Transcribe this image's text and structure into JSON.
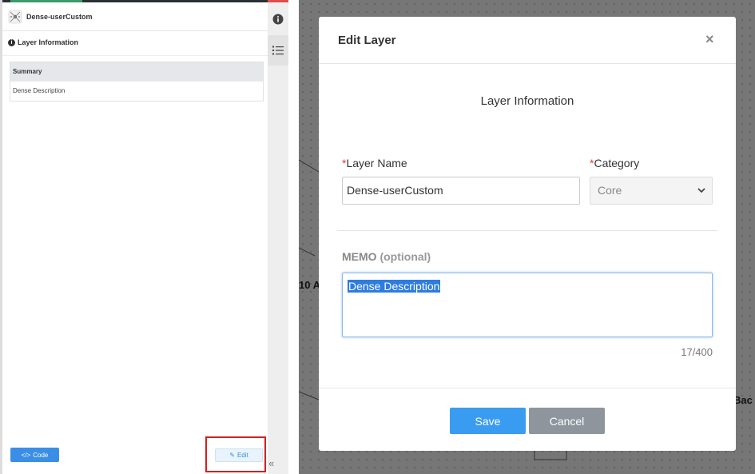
{
  "left_panel": {
    "header_title": "Dense-userCustom",
    "section_title": "Layer Information",
    "summary_header": "Summary",
    "summary_value": "Dense Description",
    "code_button": "Code",
    "edit_button": "Edit"
  },
  "side_toolbar": {
    "icons": [
      "info-icon",
      "list-icon"
    ],
    "collapse": "«"
  },
  "background": {
    "left_text": "10 A",
    "right_text": "Bac"
  },
  "modal": {
    "title": "Edit Layer",
    "close": "×",
    "subtitle": "Layer Information",
    "layer_name_label": "Layer Name",
    "layer_name_value": "Dense-userCustom",
    "category_label": "Category",
    "category_value": "Core",
    "memo_label": "MEMO",
    "memo_optional": "(optional)",
    "memo_value": "Dense Description",
    "memo_count": "17/400",
    "save": "Save",
    "cancel": "Cancel",
    "required_mark": "*"
  },
  "colors": {
    "primary": "#3a9cf0",
    "cancel": "#8e959d",
    "required": "#e23b3b",
    "highlight_box": "#d32020"
  }
}
